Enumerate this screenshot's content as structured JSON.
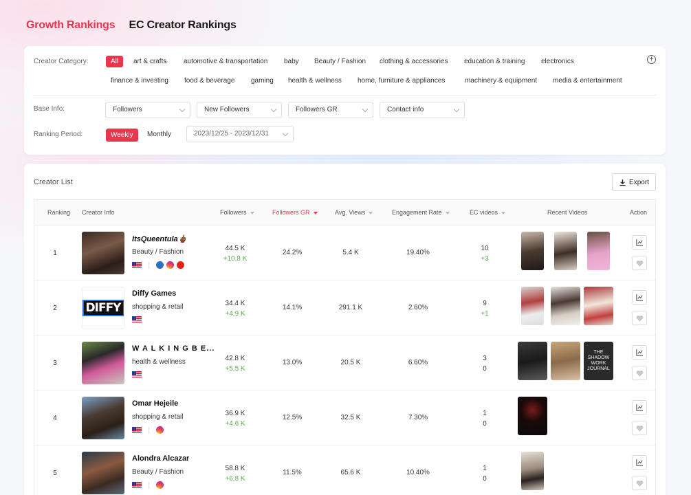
{
  "tabs": [
    {
      "label": "Growth Rankings"
    },
    {
      "label": "EC Creator Rankings"
    }
  ],
  "filters": {
    "category_label": "Creator Category:",
    "categories": [
      "All",
      "art & crafts",
      "automotive & transportation",
      "baby",
      "Beauty / Fashion",
      "clothing & accessories",
      "education & training",
      "electronics",
      "finance & investing",
      "food & beverage",
      "gaming",
      "health & wellness",
      "home, furniture & appliances",
      "machinery & equipment",
      "media & entertainment"
    ],
    "base_info_label": "Base Info:",
    "base_selects": [
      "Followers",
      "New Followers",
      "Followers GR",
      "Contact info"
    ],
    "period_label": "Ranking Period:",
    "period_weekly": "Weekly",
    "period_monthly": "Monthly",
    "date_range": "2023/12/25 - 2023/12/31"
  },
  "list": {
    "title": "Creator List",
    "export_label": "Export",
    "columns": [
      "Ranking",
      "Creator Info",
      "Followers",
      "Followers GR",
      "Avg. Views",
      "Engagement Rate",
      "EC videos",
      "Recent Videos",
      "Action"
    ],
    "rows": [
      {
        "rank": "1",
        "name": "ItsQueentula",
        "name_suffix": "🖕🏾",
        "category": "Beauty / Fashion",
        "followers": "44.5 K",
        "followers_delta": "+10.8 K",
        "growth": "24.2%",
        "views": "5.4 K",
        "engagement": "19.40%",
        "ec_videos": "10",
        "ec_delta": "+3"
      },
      {
        "rank": "2",
        "name": "Diffy Games",
        "category": "shopping & retail",
        "followers": "34.4 K",
        "followers_delta": "+4.9 K",
        "growth": "14.1%",
        "views": "291.1 K",
        "engagement": "2.60%",
        "ec_videos": "9",
        "ec_delta": "+1",
        "logo_text": "DIFFY"
      },
      {
        "rank": "3",
        "name": "W A L K I N G B E...",
        "category": "health & wellness",
        "followers": "42.8 K",
        "followers_delta": "+5.5 K",
        "growth": "13.0%",
        "views": "20.5 K",
        "engagement": "6.60%",
        "ec_videos": "3",
        "ec_delta": "0",
        "video_caption": "THE SHADOW WORK JOURNAL"
      },
      {
        "rank": "4",
        "name": "Omar Hejeile",
        "category": "shopping & retail",
        "followers": "36.9 K",
        "followers_delta": "+4.6 K",
        "growth": "12.5%",
        "views": "32.5 K",
        "engagement": "7.30%",
        "ec_videos": "1",
        "ec_delta": "0"
      },
      {
        "rank": "5",
        "name": "Alondra Alcazar",
        "category": "Beauty / Fashion",
        "followers": "58.8 K",
        "followers_delta": "+6.8 K",
        "growth": "11.5%",
        "views": "65.6 K",
        "engagement": "10.40%",
        "ec_videos": "1",
        "ec_delta": "0"
      }
    ]
  },
  "colors": {
    "accent": "#e8364f",
    "positive": "#5aa84a"
  }
}
